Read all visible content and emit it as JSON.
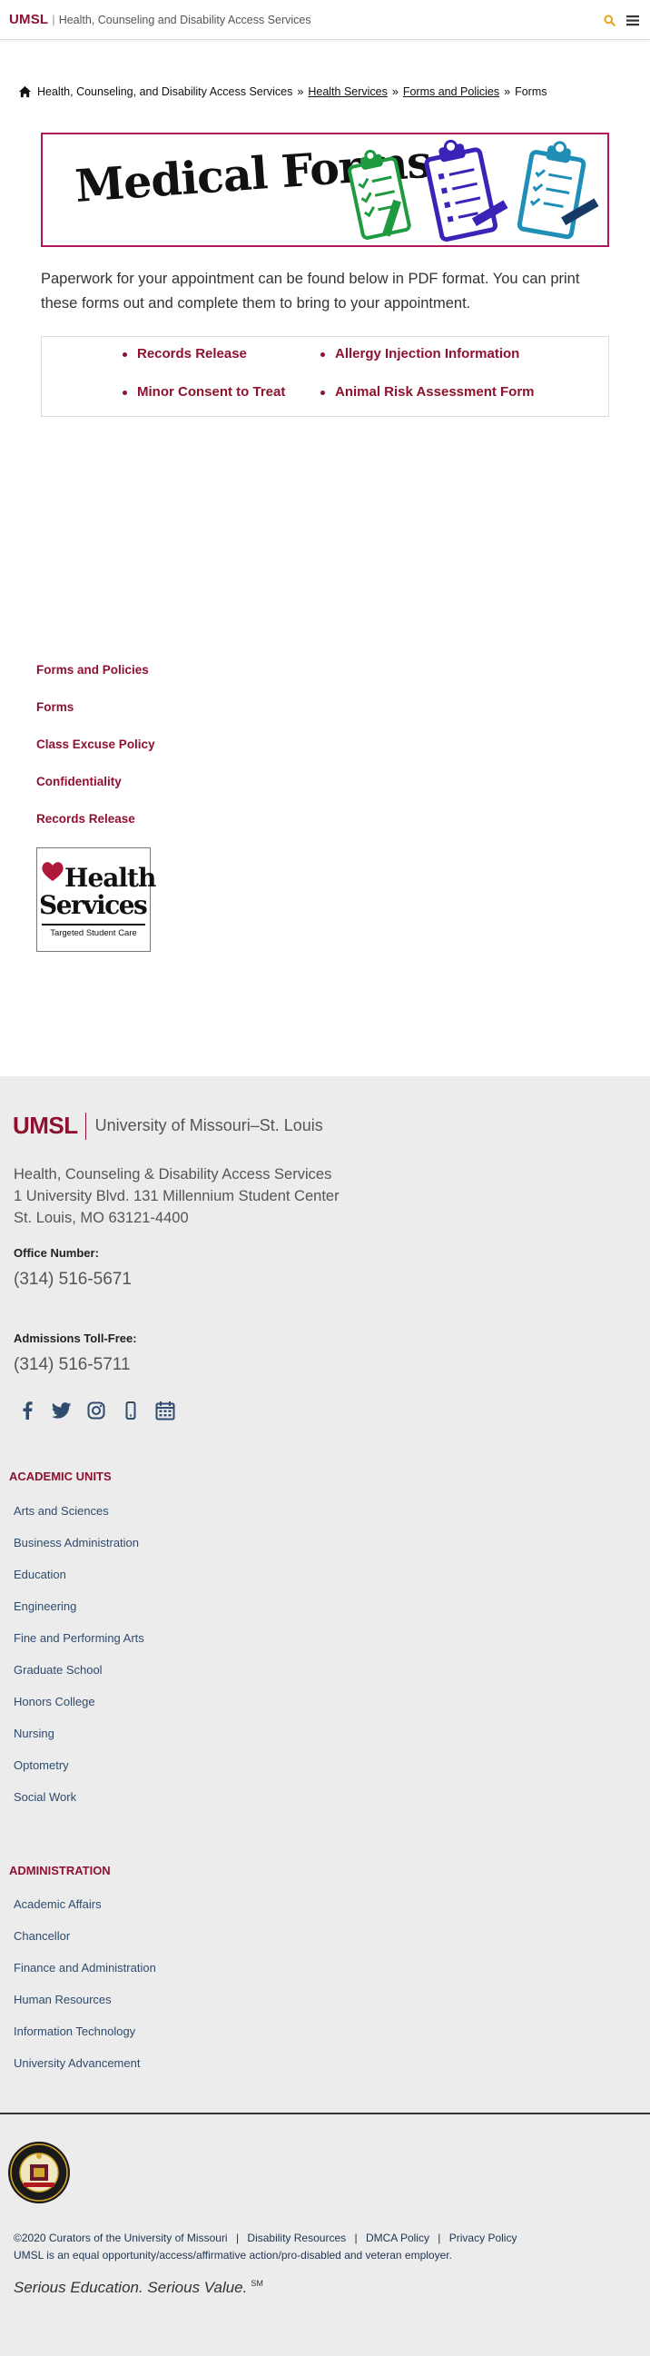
{
  "header": {
    "brand": "UMSL",
    "separator": "|",
    "site_title": "Health, Counseling and Disability Access Services"
  },
  "breadcrumb": {
    "home": "Health, Counseling, and Disability Access Services",
    "sep": "»",
    "health_services": "Health Services",
    "forms_policies": "Forms and Policies",
    "current": "Forms"
  },
  "banner": {
    "title": "Medical Forms"
  },
  "intro": "Paperwork for your appointment can be found below in PDF format. You can print these forms out and complete them to bring to your appointment.",
  "forms": {
    "records_release": "Records Release",
    "allergy": "Allergy Injection Information",
    "minor_consent": "Minor Consent to Treat",
    "animal_risk": "Animal Risk Assessment Form"
  },
  "sidebar": {
    "links": [
      "Forms and Policies",
      "Forms",
      "Class Excuse Policy",
      "Confidentiality",
      "Records Release"
    ],
    "logo": {
      "word1": "Health",
      "word2": "Services",
      "tagline": "Targeted Student Care"
    }
  },
  "footer": {
    "logo": {
      "umsl": "UMSL",
      "university": "University of Missouri–St. Louis"
    },
    "address": {
      "line1": "Health, Counseling & Disability Access Services",
      "line2": "1 University Blvd. 131 Millennium Student Center",
      "line3": "St. Louis, MO 63121-4400"
    },
    "office_label": "Office Number:",
    "office_phone": "(314) 516-5671",
    "admissions_label": "Admissions Toll-Free:",
    "admissions_phone": "(314) 516-5711",
    "academic_heading": "ACADEMIC UNITS",
    "academic_units": [
      "Arts and Sciences",
      "Business Administration",
      "Education",
      "Engineering",
      "Fine and Performing Arts",
      "Graduate School",
      "Honors College",
      "Nursing",
      "Optometry",
      "Social Work"
    ],
    "admin_heading": "ADMINISTRATION",
    "administration": [
      "Academic Affairs",
      "Chancellor",
      "Finance and Administration",
      "Human Resources",
      "Information Technology",
      "University Advancement"
    ],
    "legal": {
      "copyright": "©2020 Curators of the University of Missouri",
      "disability": "Disability Resources",
      "dmca": "DMCA Policy",
      "privacy": "Privacy Policy",
      "pipe": "|",
      "equal": "UMSL is an equal opportunity/access/affirmative action/pro-disabled and veteran employer."
    },
    "slogan": "Serious Education. Serious Value.",
    "slogan_mark": "SM"
  },
  "colors": {
    "brand": "#8e1230",
    "search_icon": "#e8a317",
    "footer_bg": "#ececec",
    "link_blue": "#2f4b6e"
  },
  "icons": {
    "search": "search-icon",
    "menu": "hamburger-menu-icon",
    "home": "home-icon",
    "social": [
      "facebook-icon",
      "twitter-icon",
      "instagram-icon",
      "mobile-icon",
      "calendar-icon"
    ]
  }
}
